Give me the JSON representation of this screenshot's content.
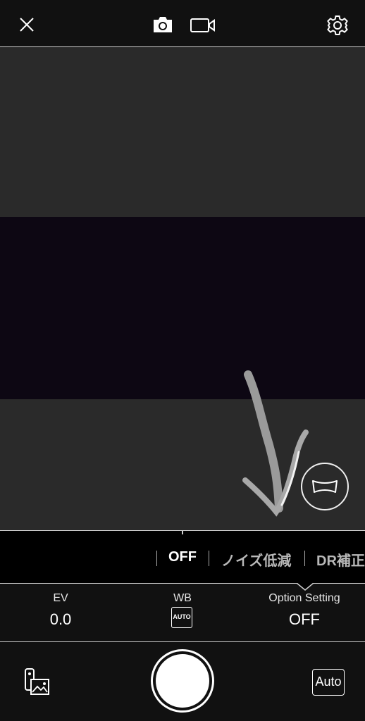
{
  "top_bar": {
    "icons": [
      "close-icon",
      "camera-icon",
      "video-icon",
      "gear-icon"
    ]
  },
  "preview": {
    "annotation": "hand-drawn-arrow",
    "lens_icon": "panorama-lens-icon"
  },
  "option_strip": {
    "items": [
      {
        "label": "OFF",
        "selected": true
      },
      {
        "label": "ノイズ低減",
        "selected": false
      },
      {
        "label": "DR補正",
        "selected": false
      }
    ]
  },
  "settings_bar": {
    "ev": {
      "label": "EV",
      "value": "0.0"
    },
    "wb": {
      "label": "WB",
      "badge": "AUTO"
    },
    "option": {
      "label": "Option Setting",
      "value": "OFF"
    }
  },
  "bottom_bar": {
    "gallery_icon": "gallery-icon",
    "shutter_icon": "shutter-button",
    "mode_label": "Auto"
  },
  "colors": {
    "background": "#000000",
    "bar": "#111111",
    "preview": "#2a2a2a",
    "band": "#0d0713",
    "text": "#ffffff"
  }
}
